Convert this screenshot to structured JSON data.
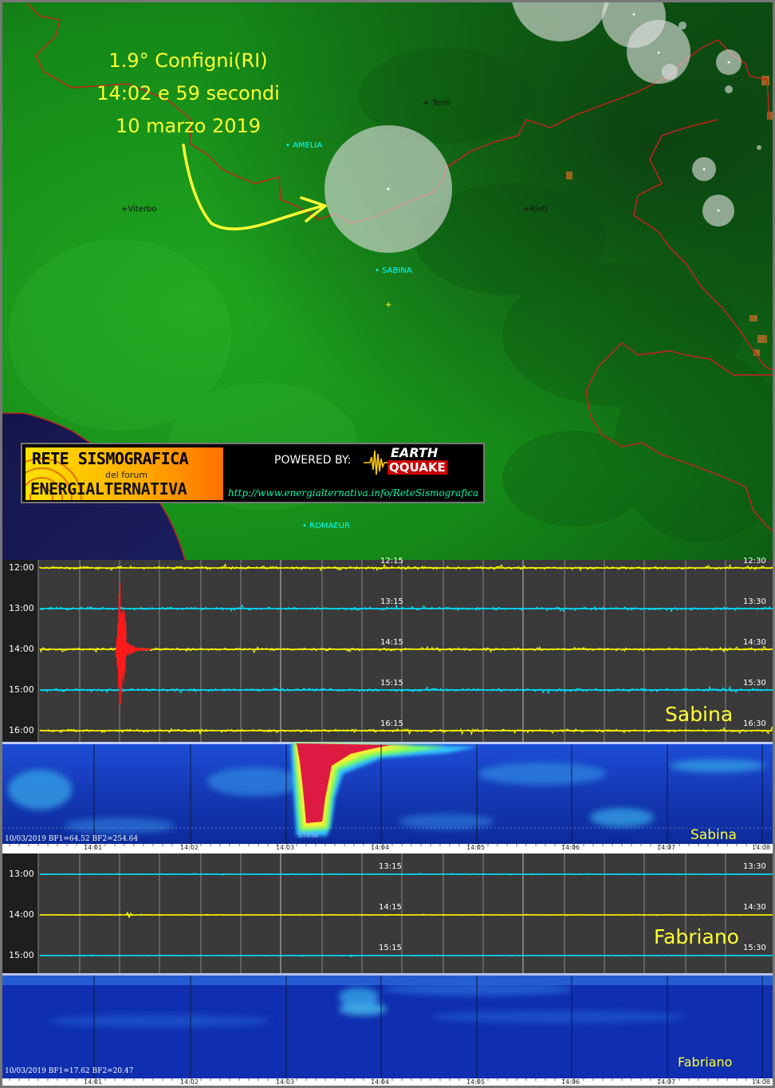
{
  "annotation": {
    "line1": "1.9° Configni(RI)",
    "line2": "14:02 e 59 secondi",
    "line3": "10 marzo 2019"
  },
  "map": {
    "places": [
      {
        "id": "terni",
        "label": "Terni",
        "kind": "city"
      },
      {
        "id": "amelia",
        "label": "AMELIA",
        "kind": "station"
      },
      {
        "id": "viterbo",
        "label": "Viterbo",
        "kind": "city"
      },
      {
        "id": "rieti",
        "label": "Rieti",
        "kind": "city"
      },
      {
        "id": "sabina",
        "label": "SABINA",
        "kind": "station"
      },
      {
        "id": "romaeur",
        "label": "ROMAEUR",
        "kind": "station"
      }
    ]
  },
  "banner": {
    "title1": "RETE SISMOGRAFICA",
    "subtitle": "del forum",
    "title2": "ENERGIALTERNATIVA",
    "powered": "POWERED BY:",
    "brand_top": "EARTH",
    "brand_bottom": "QQUAKE",
    "url": "http://www.energialternativa.info/ReteSismografica"
  },
  "seismo1": {
    "station": "Sabina",
    "rows": [
      {
        "left": "12:00",
        "mid": "12:15",
        "right": "12:30",
        "color": "#ffff00"
      },
      {
        "left": "13:00",
        "mid": "13:15",
        "right": "13:30",
        "color": "#00e5ff"
      },
      {
        "left": "14:00",
        "mid": "14:15",
        "right": "14:30",
        "color": "#ffff00"
      },
      {
        "left": "15:00",
        "mid": "15:15",
        "right": "15:30",
        "color": "#00e5ff"
      },
      {
        "left": "16:00",
        "mid": "16:15",
        "right": "16:30",
        "color": "#ffff00"
      }
    ]
  },
  "spectro1": {
    "station": "Sabina",
    "info": "10/03/2019 BF1=64.52 BF2=254.64",
    "marker": "STRTA",
    "ticks": [
      "14:01",
      "14:02",
      "14:03",
      "14:04",
      "14:05",
      "14:06",
      "14:07",
      "14:08"
    ]
  },
  "seismo2": {
    "station": "Fabriano",
    "rows": [
      {
        "left": "13:00",
        "mid": "13:15",
        "right": "13:30",
        "color": "#00e5ff"
      },
      {
        "left": "14:00",
        "mid": "14:15",
        "right": "14:30",
        "color": "#ffff00"
      },
      {
        "left": "15:00",
        "mid": "15:15",
        "right": "15:30",
        "color": "#00e5ff"
      }
    ]
  },
  "spectro2": {
    "station": "Fabriano",
    "info": "10/03/2019 BF1=17.62 BF2=20.47",
    "ticks": [
      "14:01",
      "14:02",
      "14:03",
      "14:04",
      "14:05",
      "14:06",
      "14:07",
      "14:08"
    ]
  },
  "colors": {
    "annotation": "#ffff33",
    "border": "#cc2222",
    "station_label": "#00ffff"
  }
}
